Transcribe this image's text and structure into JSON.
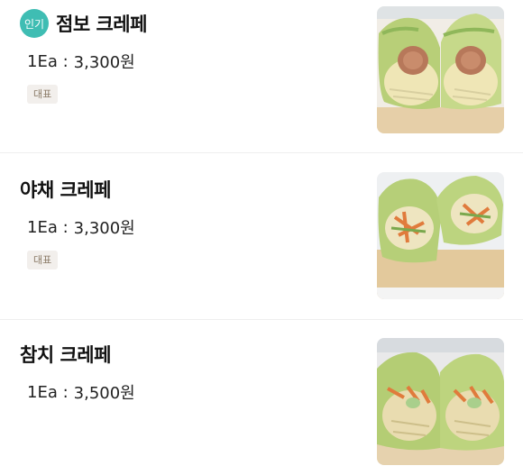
{
  "menu": {
    "items": [
      {
        "name": "점보 크레페",
        "price_prefix": "1Ea :",
        "price": "3,300원",
        "popular_badge": "인기",
        "tag": "대표",
        "image_icon": "crepe-photo-icon"
      },
      {
        "name": "야채 크레페",
        "price_prefix": "1Ea :",
        "price": "3,300원",
        "tag": "대표",
        "image_icon": "crepe-photo-icon"
      },
      {
        "name": "참치 크레페",
        "price_prefix": "1Ea :",
        "price": "3,500원",
        "image_icon": "crepe-photo-icon"
      }
    ]
  },
  "colors": {
    "popular_badge": "#3fbdb3",
    "tag_background": "#f2efec",
    "tag_text": "#8a7a66",
    "divider": "#eeeeee"
  }
}
